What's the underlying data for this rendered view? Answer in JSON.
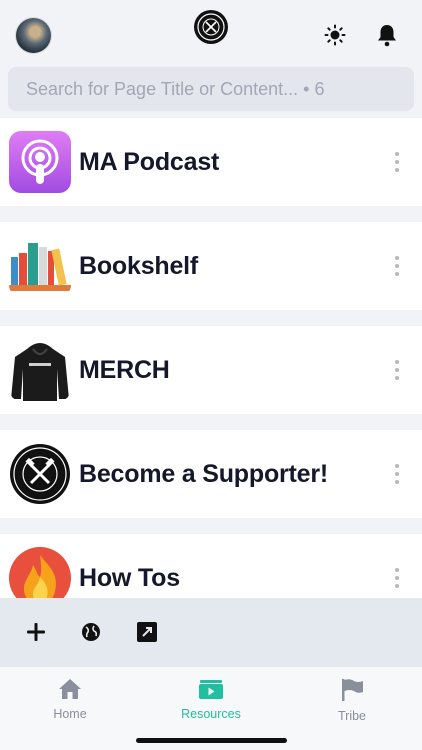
{
  "header": {
    "avatar_icon": "user-avatar",
    "logo_icon": "mens-alliance-logo",
    "theme_icon": "sun-icon",
    "notifications_icon": "bell-icon"
  },
  "search": {
    "placeholder": "Search for Page Title or Content... • 6"
  },
  "pages": [
    {
      "title": "MA Podcast",
      "icon": "podcast-icon"
    },
    {
      "title": "Bookshelf",
      "icon": "books-icon"
    },
    {
      "title": "MERCH",
      "icon": "hoodie-icon"
    },
    {
      "title": "Become a Supporter!",
      "icon": "mens-alliance-badge"
    },
    {
      "title": "How Tos",
      "icon": "fire-icon"
    }
  ],
  "toolbar": {
    "add_icon": "plus-icon",
    "web_icon": "globe-icon",
    "open_icon": "external-link-icon"
  },
  "tabbar": {
    "tabs": [
      {
        "label": "Home",
        "icon": "home-icon"
      },
      {
        "label": "Resources",
        "icon": "play-folder-icon"
      },
      {
        "label": "Tribe",
        "icon": "flag-icon"
      }
    ],
    "active_tab": "Resources",
    "active_color": "#1fbf9f",
    "inactive_color": "#8a8f9c"
  }
}
